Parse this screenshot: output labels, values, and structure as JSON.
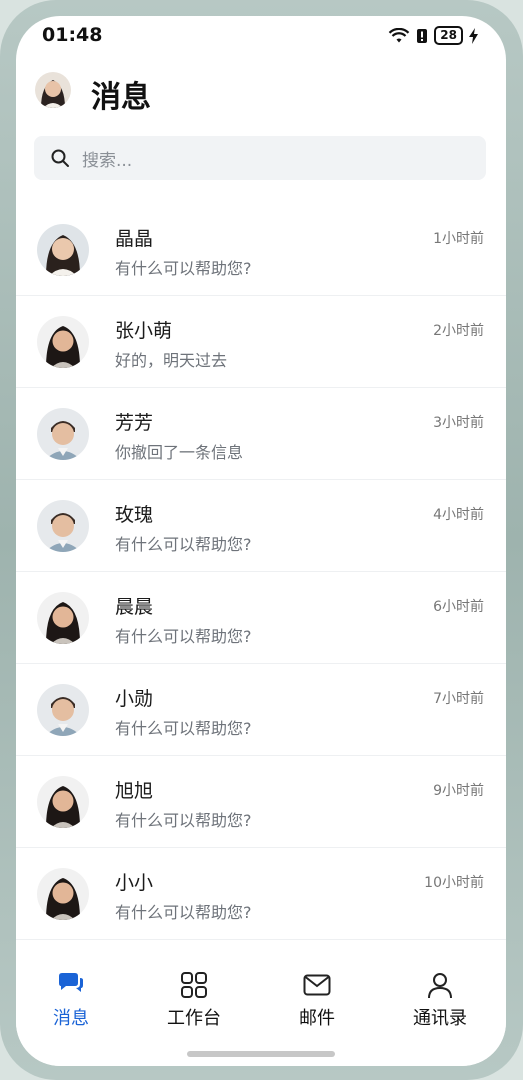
{
  "status_bar": {
    "time": "01:48",
    "battery": "28",
    "icons": [
      "wifi-icon",
      "alert-icon",
      "battery-icon",
      "charging-icon"
    ]
  },
  "header": {
    "title": "消息"
  },
  "search": {
    "placeholder": "搜索..."
  },
  "chats": [
    {
      "name": "晶晶",
      "message": "有什么可以帮助您?",
      "time": "1小时前",
      "avatar": "woman-avatar"
    },
    {
      "name": "张小萌",
      "message": "好的，明天过去",
      "time": "2小时前",
      "avatar": "woman-avatar"
    },
    {
      "name": "芳芳",
      "message": "你撤回了一条信息",
      "time": "3小时前",
      "avatar": "man-avatar"
    },
    {
      "name": "玫瑰",
      "message": "有什么可以帮助您?",
      "time": "4小时前",
      "avatar": "man-avatar"
    },
    {
      "name": "晨晨",
      "message": "有什么可以帮助您?",
      "time": "6小时前",
      "avatar": "woman-avatar"
    },
    {
      "name": "小勋",
      "message": "有什么可以帮助您?",
      "time": "7小时前",
      "avatar": "man-avatar"
    },
    {
      "name": "旭旭",
      "message": "有什么可以帮助您?",
      "time": "9小时前",
      "avatar": "woman-avatar"
    },
    {
      "name": "小小",
      "message": "有什么可以帮助您?",
      "time": "10小时前",
      "avatar": "woman-avatar"
    }
  ],
  "bottom_nav": [
    {
      "label": "消息",
      "icon": "chat-bubbles-icon",
      "active": true
    },
    {
      "label": "工作台",
      "icon": "grid-icon",
      "active": false
    },
    {
      "label": "邮件",
      "icon": "mail-icon",
      "active": false
    },
    {
      "label": "通讯录",
      "icon": "contacts-icon",
      "active": false
    }
  ],
  "colors": {
    "accent": "#1a63d6",
    "background": "#ffffff",
    "search_bg": "#f1f3f5"
  }
}
